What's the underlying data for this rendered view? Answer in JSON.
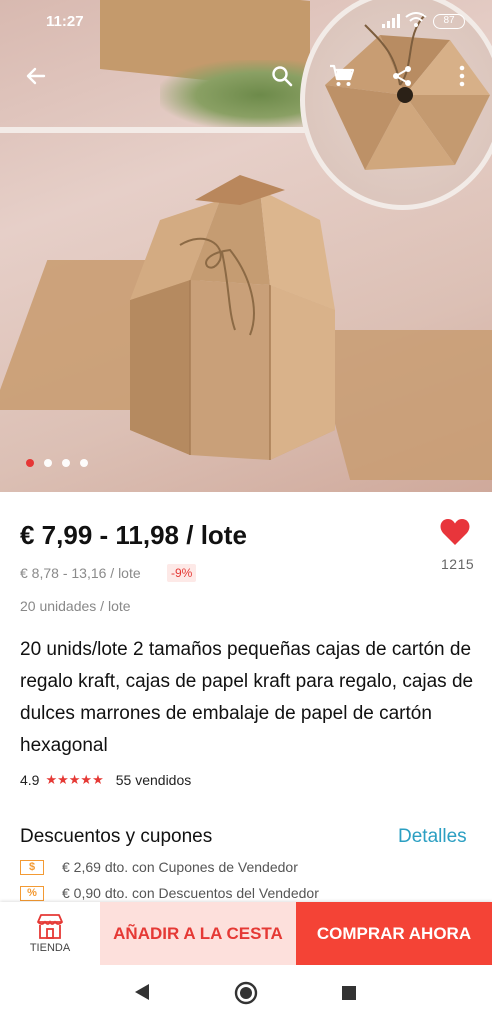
{
  "status_bar": {
    "time": "11:27",
    "battery": "87"
  },
  "toolbar": {
    "icons": [
      "back-arrow-icon",
      "search-icon",
      "cart-icon",
      "share-icon",
      "more-vert-icon"
    ]
  },
  "carousel": {
    "total": 4,
    "active": 0
  },
  "product": {
    "price": "€ 7,99 - 11,98 / lote",
    "old_price": "€ 8,78 - 13,16 / lote",
    "discount": "-9%",
    "units": "20 unidades / lote",
    "title": "20 unids/lote 2 tamaños pequeñas cajas de cartón de regalo kraft, cajas de papel kraft para regalo, cajas de dulces marrones de embalaje de papel de cartón hexagonal",
    "rating": "4.9",
    "stars": "★★★★★",
    "sold": "55 vendidos",
    "favorites": "1215"
  },
  "discounts": {
    "title": "Descuentos y cupones",
    "link": "Detalles",
    "items": [
      {
        "icon_text": "$",
        "text": "€ 2,69 dto. con Cupones de Vendedor"
      },
      {
        "icon_text": "%",
        "text": "€ 0,90 dto. con Descuentos del Vendedor"
      }
    ]
  },
  "actions": {
    "store_label": "TIENDA",
    "add_to_cart": "AÑADIR A LA CESTA",
    "buy_now": "COMPRAR AHORA"
  },
  "colors": {
    "accent": "#f44336",
    "link": "#2b9fc2",
    "coupon": "#f39a33",
    "star": "#e53935"
  }
}
